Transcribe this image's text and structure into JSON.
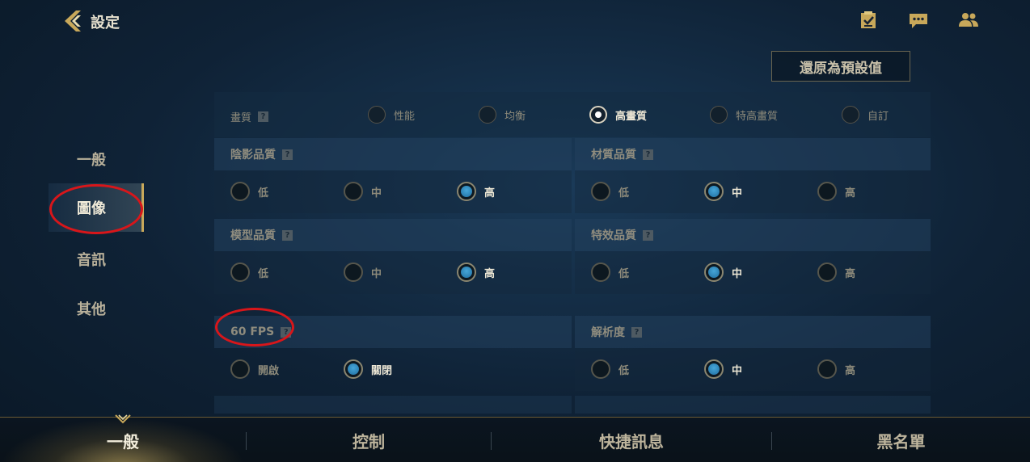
{
  "header": {
    "title": "設定",
    "icons": [
      "back-arrow-icon",
      "checklist-icon",
      "chat-icon",
      "friends-icon"
    ]
  },
  "reset_button": "還原為預設值",
  "sidenav": {
    "items": [
      {
        "label": "一般",
        "active": false
      },
      {
        "label": "圖像",
        "active": true
      },
      {
        "label": "音訊",
        "active": false
      },
      {
        "label": "其他",
        "active": false
      }
    ]
  },
  "help_glyph": "?",
  "quality": {
    "label": "畫質",
    "options": [
      "性能",
      "均衡",
      "高畫質",
      "特高畫質",
      "自訂"
    ],
    "selected": "高畫質"
  },
  "panels": {
    "shadow": {
      "label": "陰影品質",
      "options": [
        "低",
        "中",
        "高"
      ],
      "selected": "高"
    },
    "texture": {
      "label": "材質品質",
      "options": [
        "低",
        "中",
        "高"
      ],
      "selected": "中"
    },
    "model": {
      "label": "模型品質",
      "options": [
        "低",
        "中",
        "高"
      ],
      "selected": "高"
    },
    "effects": {
      "label": "特效品質",
      "options": [
        "低",
        "中",
        "高"
      ],
      "selected": "中"
    },
    "fps": {
      "label": "60 FPS",
      "options": [
        "開啟",
        "關閉"
      ],
      "selected": "關閉"
    },
    "resolution": {
      "label": "解析度",
      "options": [
        "低",
        "中",
        "高"
      ],
      "selected": "中"
    }
  },
  "bottom_tabs": [
    {
      "label": "一般",
      "active": true
    },
    {
      "label": "控制",
      "active": false
    },
    {
      "label": "快捷訊息",
      "active": false
    },
    {
      "label": "黑名單",
      "active": false
    }
  ],
  "colors": {
    "accent_gold": "#c8a85a",
    "selected_blue": "#46a6d8",
    "annotation_red": "#d8161a"
  }
}
